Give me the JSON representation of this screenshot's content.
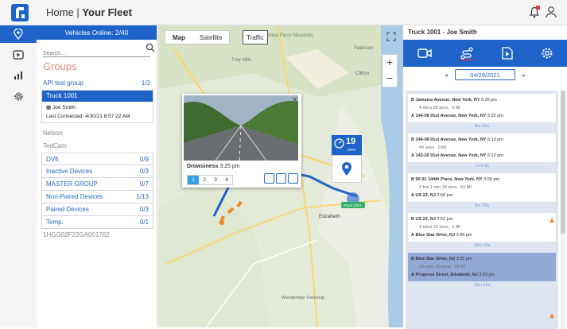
{
  "header": {
    "home": "Home",
    "sep": "|",
    "title": "Your Fleet"
  },
  "vehicles": {
    "online": "Vehicles Online: 2/40",
    "search_placeholder": "Search...",
    "groups_title": "Groups"
  },
  "groups": [
    {
      "name": "API test group",
      "count": "1/3"
    }
  ],
  "selected_truck": {
    "name": "Truck 1001",
    "driver": "Joe Smith",
    "last_connected": "Last Connected: 4/30/21 8:57:22 AM"
  },
  "plain_rows": [
    "Nelson",
    "TedCam"
  ],
  "group_rows": [
    {
      "name": "DV6",
      "count": "0/9"
    },
    {
      "name": "Inactive Devices",
      "count": "0/3"
    },
    {
      "name": "MASTER GROUP",
      "count": "0/7"
    },
    {
      "name": "Non-Paired Devices",
      "count": "1/13"
    },
    {
      "name": "Paired Devices",
      "count": "0/3"
    },
    {
      "name": "Temp.",
      "count": "0/1"
    }
  ],
  "device_id": "1HGG02F22GA001762",
  "map": {
    "tab_map": "Map",
    "tab_satellite": "Satellite",
    "traffic": "Traffic",
    "zoom_in": "+",
    "zoom_out": "−",
    "event_label": "Drowsiness",
    "event_time": "3:25 pm",
    "pages": [
      "1",
      "2",
      "3",
      "4"
    ],
    "speed": "19",
    "speed_unit": "MPH",
    "places": [
      "Great Piece Meadows",
      "Troy Hills",
      "Clifton",
      "Paterson",
      "Elizabeth",
      "Woodbridge Township",
      "Truck 1001"
    ]
  },
  "panel": {
    "title": "Truck 1001 - Joe Smith",
    "date": "04/29/2021",
    "prev": "«",
    "next": "»"
  },
  "trips": [
    {
      "b": "Jamaica Avenue, New York, NY",
      "bt": "6:26 pm",
      "dur": "4 mins 25 secs",
      "dist": "0 Mi",
      "a": "144-08 91st Avenue, New York, NY",
      "at": "6:22 pm",
      "gap": "8m 25s"
    },
    {
      "b": "144-08 91st Avenue, New York, NY",
      "bt": "6:13 pm",
      "dur": "40 secs",
      "dist": "0 Mi",
      "a": "143-20 91st Avenue, New York, NY",
      "at": "6:12 pm",
      "gap": "12m 5s"
    },
    {
      "b": "90-31 144th Place, New York, NY",
      "bt": "3:59 pm",
      "dur": "2 hrs 1 min 19 secs",
      "dist": "51 Mi",
      "a": "US 22, NJ",
      "at": "3:58 pm",
      "gap": "5m 25s"
    },
    {
      "b": "US 22, NJ",
      "bt": "3:52 pm",
      "dur": "3 mins 15 secs",
      "dist": "1 Mi",
      "a": "Blue Star Drive, NJ",
      "at": "3:49 pm",
      "gap": "13m 30s"
    },
    {
      "b": "Blue Star Drive, NJ",
      "bt": "3:35 pm",
      "dur": "32 mins 30 secs",
      "dist": "14 Mi",
      "a": "Progress Street, Elizabeth, NJ",
      "at": "3:03 pm",
      "gap": "13m 45s"
    }
  ]
}
